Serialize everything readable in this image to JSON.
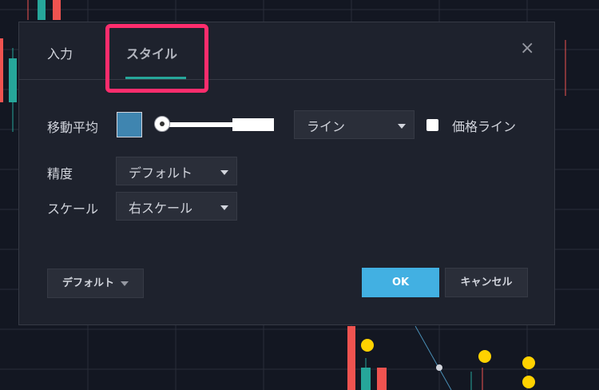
{
  "dialog": {
    "tabs": [
      {
        "label": "入力"
      },
      {
        "label": "スタイル",
        "active": true
      }
    ],
    "close_glyph": "×",
    "rows": {
      "moving_average": {
        "label": "移動平均",
        "color": "#3f85b0",
        "line_style": "ライン",
        "price_line_label": "価格ライン",
        "price_line_checked": false
      },
      "precision": {
        "label": "精度",
        "value": "デフォルト"
      },
      "scale": {
        "label": "スケール",
        "value": "右スケール"
      }
    },
    "buttons": {
      "defaults": "デフォルト",
      "ok": "OK",
      "cancel": "キャンセル"
    }
  },
  "colors": {
    "background": "#131722",
    "dialog": "#1e222d",
    "accent_underline": "#26a69a",
    "highlight": "#ff2d6d",
    "ok_button": "#42b0e2",
    "candle_up": "#26a69a",
    "candle_down": "#ef5350",
    "marker": "#ffd200"
  },
  "icons": [
    "close-icon",
    "caret-down-icon",
    "slider-knob-icon"
  ]
}
